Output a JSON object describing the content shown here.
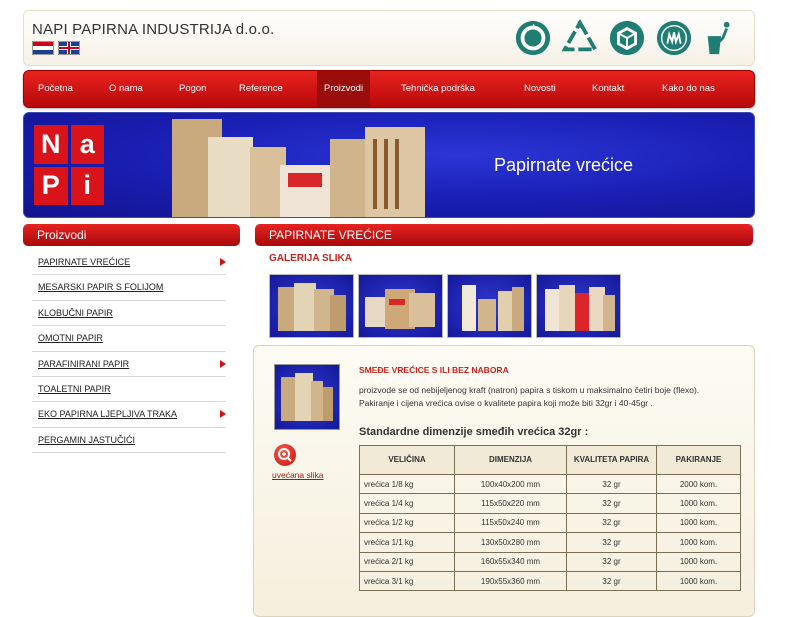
{
  "header": {
    "title": "NAPI PAPIRNA INDUSTRIJA d.o.o.",
    "eco_icons": [
      "recycle-circle-icon",
      "recycle-triangle-icon",
      "cardboard-box-icon",
      "eco-label-icon",
      "trash-bin-icon"
    ]
  },
  "nav": {
    "items": [
      {
        "label": "Početna"
      },
      {
        "label": "O nama"
      },
      {
        "label": "Pogon"
      },
      {
        "label": "Reference"
      },
      {
        "label": "Proizvodi",
        "active": true
      },
      {
        "label": "Tehnička podrška"
      },
      {
        "label": "Novosti"
      },
      {
        "label": "Kontakt"
      },
      {
        "label": "Kako do nas"
      }
    ]
  },
  "banner": {
    "logo_letters": [
      "Na",
      "P",
      "i"
    ],
    "text": "Papirnate vrećice"
  },
  "sidebar": {
    "title": "Proizvodi",
    "items": [
      {
        "label": "PAPIRNATE VREĆICE",
        "arrow": true
      },
      {
        "label": "MESARSKI PAPIR S FOLIJOM",
        "arrow": false
      },
      {
        "label": "KLOBUČNI PAPIR",
        "arrow": false
      },
      {
        "label": "OMOTNI PAPIR",
        "arrow": false
      },
      {
        "label": "PARAFINIRANI PAPIR",
        "arrow": true
      },
      {
        "label": "TOALETNI PAPIR",
        "arrow": false
      },
      {
        "label": "EKO PAPIRNA LJEPLJIVA TRAKA",
        "arrow": true
      },
      {
        "label": "PERGAMIN JASTUČIĆI",
        "arrow": false
      }
    ]
  },
  "main": {
    "title": "PAPIRNATE VREĆICE",
    "gallery_title": "GALERIJA SLIKA",
    "product": {
      "title": "SMEĐE VREĆICE S ILI BEZ NABORA",
      "description": "proizvode se od nebijeljenog kraft (natron) papira s tiskom u maksimalno četiri boje (flexo). Pakiranje i cijena vrećica ovise o kvalitete papira koji može biti 32gr i 40-45gr .",
      "zoom_label": "uvećana slika",
      "dims_title": "Standardne dimenzije smeđih vrećica 32gr :"
    },
    "table": {
      "headers": [
        "VELIČINA",
        "DIMENZIJA",
        "KVALITETA PAPIRA",
        "PAKIRANJE"
      ],
      "rows": [
        [
          "vrećica 1/8 kg",
          "100x40x200 mm",
          "32 gr",
          "2000 kom."
        ],
        [
          "vrećica 1/4 kg",
          "115x50x220 mm",
          "32 gr",
          "1000 kom."
        ],
        [
          "vrećica 1/2 kg",
          "115x50x240 mm",
          "32 gr",
          "1000 kom."
        ],
        [
          "vrećica 1/1 kg",
          "130x50x280 mm",
          "32 gr",
          "1000 kom."
        ],
        [
          "vrećica 2/1 kg",
          "160x55x340 mm",
          "32 gr",
          "1000 kom."
        ],
        [
          "vrećica 3/1 kg",
          "190x55x360 mm",
          "32 gr",
          "1000 kom."
        ]
      ]
    }
  },
  "colors": {
    "nav_red": "#d0140f",
    "banner_blue": "#1a1fb5",
    "accent_red": "#c9251c"
  }
}
